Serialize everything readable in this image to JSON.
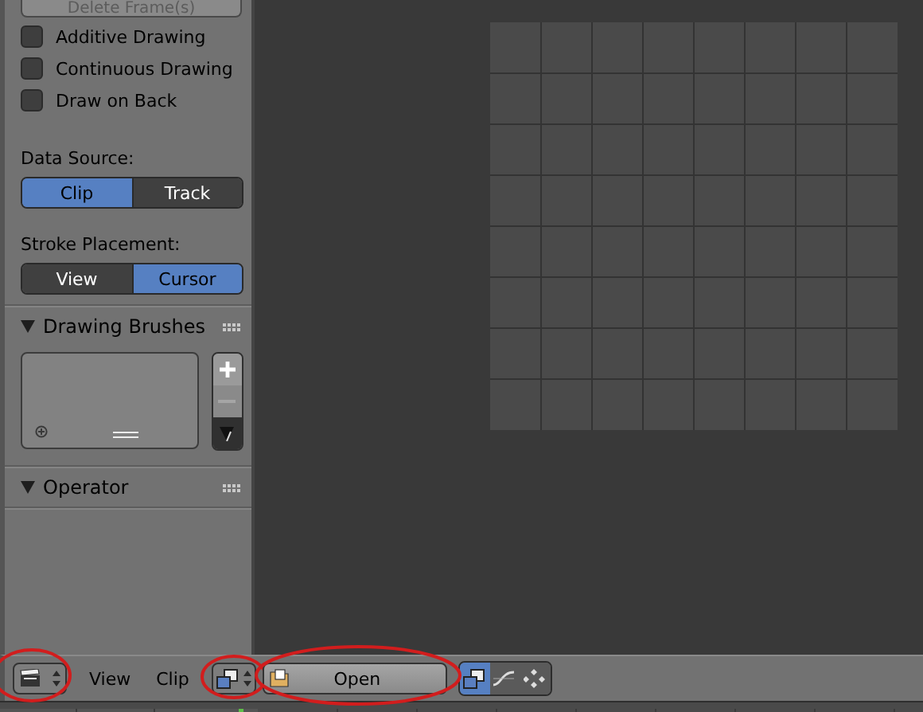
{
  "sidebar": {
    "delete_button": {
      "label": "Delete Frame(s)",
      "disabled": true
    },
    "options": [
      {
        "label": "Additive Drawing",
        "checked": false
      },
      {
        "label": "Continuous Drawing",
        "checked": false
      },
      {
        "label": "Draw on Back",
        "checked": false
      }
    ],
    "data_source": {
      "label": "Data Source:",
      "options": [
        {
          "label": "Clip",
          "selected": true
        },
        {
          "label": "Track",
          "selected": false
        }
      ]
    },
    "stroke_placement": {
      "label": "Stroke Placement:",
      "options": [
        {
          "label": "View",
          "selected": false
        },
        {
          "label": "Cursor",
          "selected": true
        }
      ]
    },
    "panels": [
      {
        "title": "Drawing Brushes",
        "expanded": true,
        "kind": "brush-list"
      },
      {
        "title": "Operator",
        "expanded": true,
        "kind": "empty"
      }
    ]
  },
  "header": {
    "editor_button": {
      "circled": true
    },
    "menus": [
      {
        "label": "View"
      },
      {
        "label": "Clip"
      }
    ],
    "display_button": {
      "circled": true
    },
    "open_button": {
      "label": "Open",
      "circled": true
    },
    "modes": [
      {
        "kind": "clip",
        "selected": true
      },
      {
        "kind": "graph",
        "selected": false
      },
      {
        "kind": "dopesheet",
        "selected": false
      }
    ]
  }
}
